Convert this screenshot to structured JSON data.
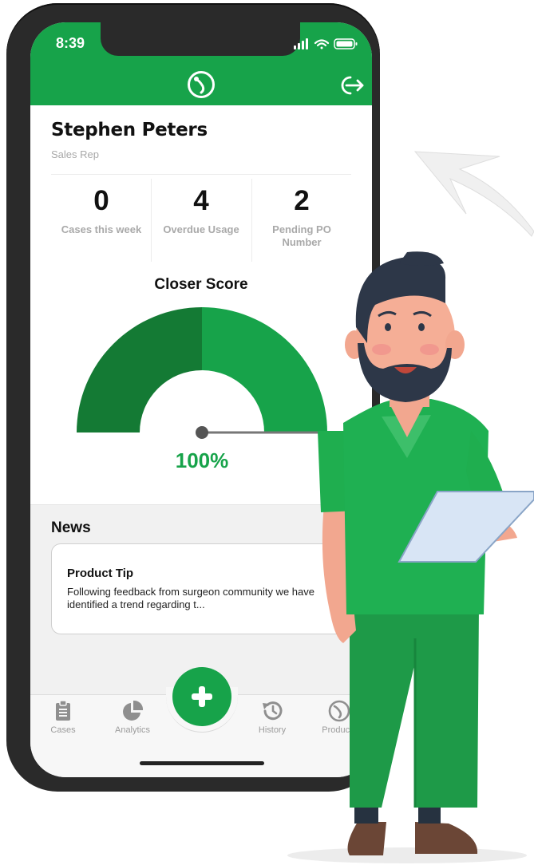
{
  "status_bar": {
    "time": "8:39",
    "icons": [
      "signal-icon",
      "wifi-icon",
      "battery-icon"
    ]
  },
  "header": {
    "logo_icon": "app-logo-icon",
    "logout_icon": "logout-icon",
    "color": "#17a34a"
  },
  "profile": {
    "name": "Stephen Peters",
    "role": "Sales Rep"
  },
  "stats": [
    {
      "value": "0",
      "label": "Cases this week"
    },
    {
      "value": "4",
      "label": "Overdue Usage"
    },
    {
      "value": "2",
      "label": "Pending PO Number"
    }
  ],
  "closer_score": {
    "title": "Closer Score",
    "value_text": "100%",
    "value": 100,
    "colors": {
      "left": "#147a34",
      "right": "#17a34a"
    }
  },
  "news": {
    "heading": "News",
    "items": [
      {
        "title": "Product Tip",
        "body": "Following feedback from surgeon community we have identified a trend regarding t..."
      }
    ]
  },
  "tab_bar": {
    "tabs": [
      {
        "label": "Cases",
        "icon": "clipboard-icon"
      },
      {
        "label": "Analytics",
        "icon": "pie-chart-icon"
      },
      {
        "label": "History",
        "icon": "history-icon"
      },
      {
        "label": "Products",
        "icon": "product-logo-icon"
      }
    ],
    "add_icon": "plus-icon"
  },
  "theme": {
    "accent": "#17a34a",
    "accent_dark": "#147a34"
  }
}
